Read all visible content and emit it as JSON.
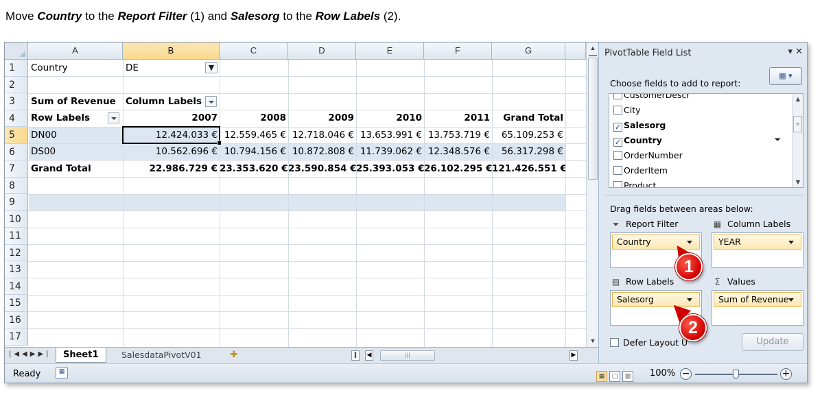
{
  "instruction": {
    "p1": "Move ",
    "field1": "Country",
    "p2": " to the ",
    "area1": "Report Filter",
    "p3": " (1) and ",
    "field2": "Salesorg",
    "p4": " to the ",
    "area2": "Row Labels",
    "p5": " (2)."
  },
  "columns": [
    "A",
    "B",
    "C",
    "D",
    "E",
    "F",
    "G"
  ],
  "rows": [
    "1",
    "2",
    "3",
    "4",
    "5",
    "6",
    "7",
    "8",
    "9",
    "10",
    "11",
    "12",
    "13",
    "14",
    "15",
    "16",
    "17"
  ],
  "cells": {
    "a1": "Country",
    "b1": "DE",
    "a3": "Sum of Revenue",
    "b3": "Column Labels",
    "a4": "Row Labels",
    "b4": "2007",
    "c4": "2008",
    "d4": "2009",
    "e4": "2010",
    "f4": "2011",
    "g4": "Grand Total",
    "a5": "DN00",
    "b5": "12.424.033 €",
    "c5": "12.559.465 €",
    "d5": "12.718.046 €",
    "e5": "13.653.991 €",
    "f5": "13.753.719 €",
    "g5": "65.109.253 €",
    "a6": "DS00",
    "b6": "10.562.696 €",
    "c6": "10.794.156 €",
    "d6": "10.872.808 €",
    "e6": "11.739.062 €",
    "f6": "12.348.576 €",
    "g6": "56.317.298 €",
    "a7": "Grand Total",
    "b7": "22.986.729 €",
    "c7": "23.353.620 €",
    "d7": "23.590.854 €",
    "e7": "25.393.053 €",
    "f7": "26.102.295 €",
    "g7": "121.426.551 €"
  },
  "sheet_tabs": {
    "active": "Sheet1",
    "other": "SalesdataPivotV01"
  },
  "status": {
    "ready": "Ready",
    "zoom": "100%"
  },
  "pivot_pane": {
    "title": "PivotTable Field List",
    "choose_label": "Choose fields to add to report:",
    "fields": [
      {
        "label": "CustomerDescr",
        "checked": false
      },
      {
        "label": "City",
        "checked": false
      },
      {
        "label": "Salesorg",
        "checked": true
      },
      {
        "label": "Country",
        "checked": true
      },
      {
        "label": "OrderNumber",
        "checked": false
      },
      {
        "label": "OrderItem",
        "checked": false
      },
      {
        "label": "Product",
        "checked": false
      }
    ],
    "drag_label": "Drag fields between areas below:",
    "report_filter_label": "Report Filter",
    "column_labels_label": "Column Labels",
    "row_labels_label": "Row Labels",
    "values_label": "Values",
    "report_filter_field": "Country",
    "column_labels_field": "YEAR",
    "row_labels_field": "Salesorg",
    "values_field": "Sum of Revenue",
    "defer_label": "Defer Layout U",
    "update_label": "Update"
  },
  "callouts": [
    "1",
    "2"
  ],
  "colors": {
    "header_band": "#dce6f1",
    "selected_header": "#f9d98e",
    "callout": "#d00000",
    "pill": "#fde7b1"
  }
}
